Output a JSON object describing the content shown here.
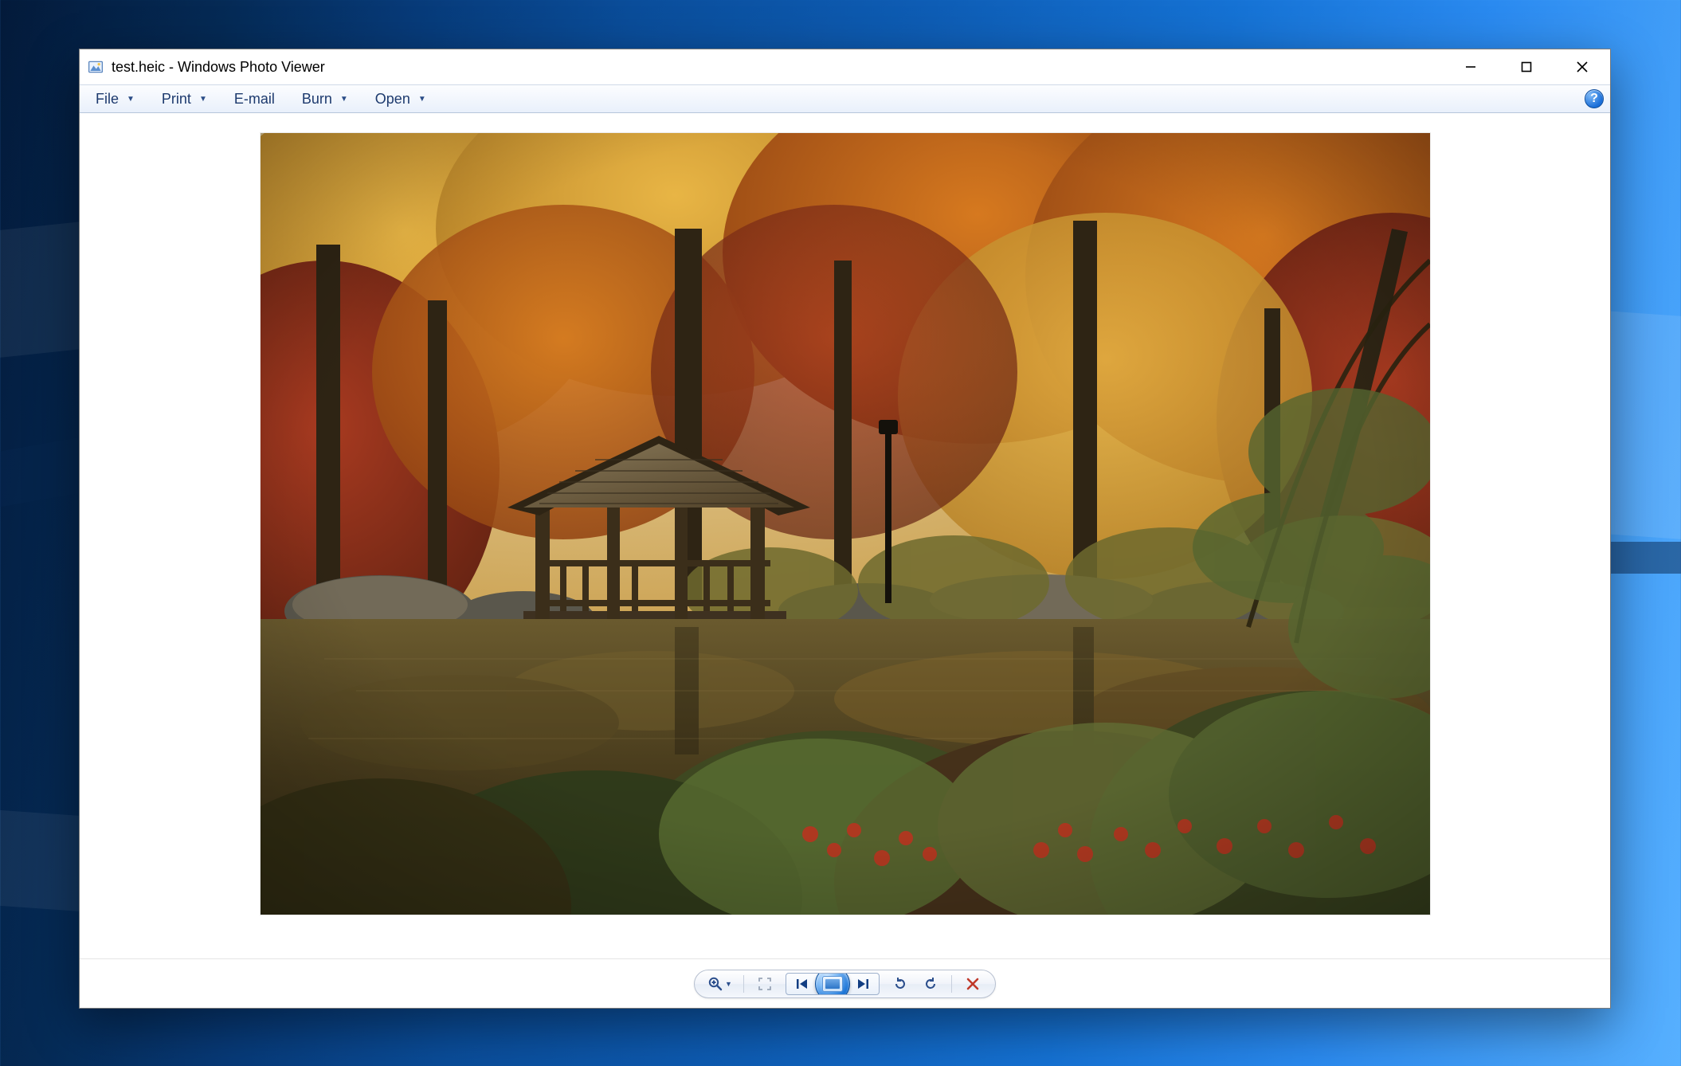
{
  "window": {
    "title": "test.heic - Windows Photo Viewer",
    "app_name": "Windows Photo Viewer",
    "file_name": "test.heic"
  },
  "menu": {
    "file": "File",
    "print": "Print",
    "email": "E-mail",
    "burn": "Burn",
    "open": "Open"
  },
  "navbar": {
    "zoom": "Change the display size",
    "fit": "Actual size",
    "previous": "Previous",
    "slideshow": "Play slide show",
    "next": "Next",
    "rotate_ccw": "Rotate counterclockwise",
    "rotate_cw": "Rotate clockwise",
    "delete": "Delete"
  },
  "image": {
    "description": "Autumn park scene: a small wooden shingle-roofed gazebo / boat shelter stands at the edge of a calm pond. Surrounding trees show fall foliage in orange, gold, amber and dark red. The water reflects the warm colors; foreground shrubs with red berries and green leaves are softly out of focus.",
    "dominant_colors": [
      "#b9802a",
      "#d99a2e",
      "#e2ae3a",
      "#7a4a1e",
      "#3d2a12",
      "#5a6b2d",
      "#2f3a16"
    ]
  }
}
